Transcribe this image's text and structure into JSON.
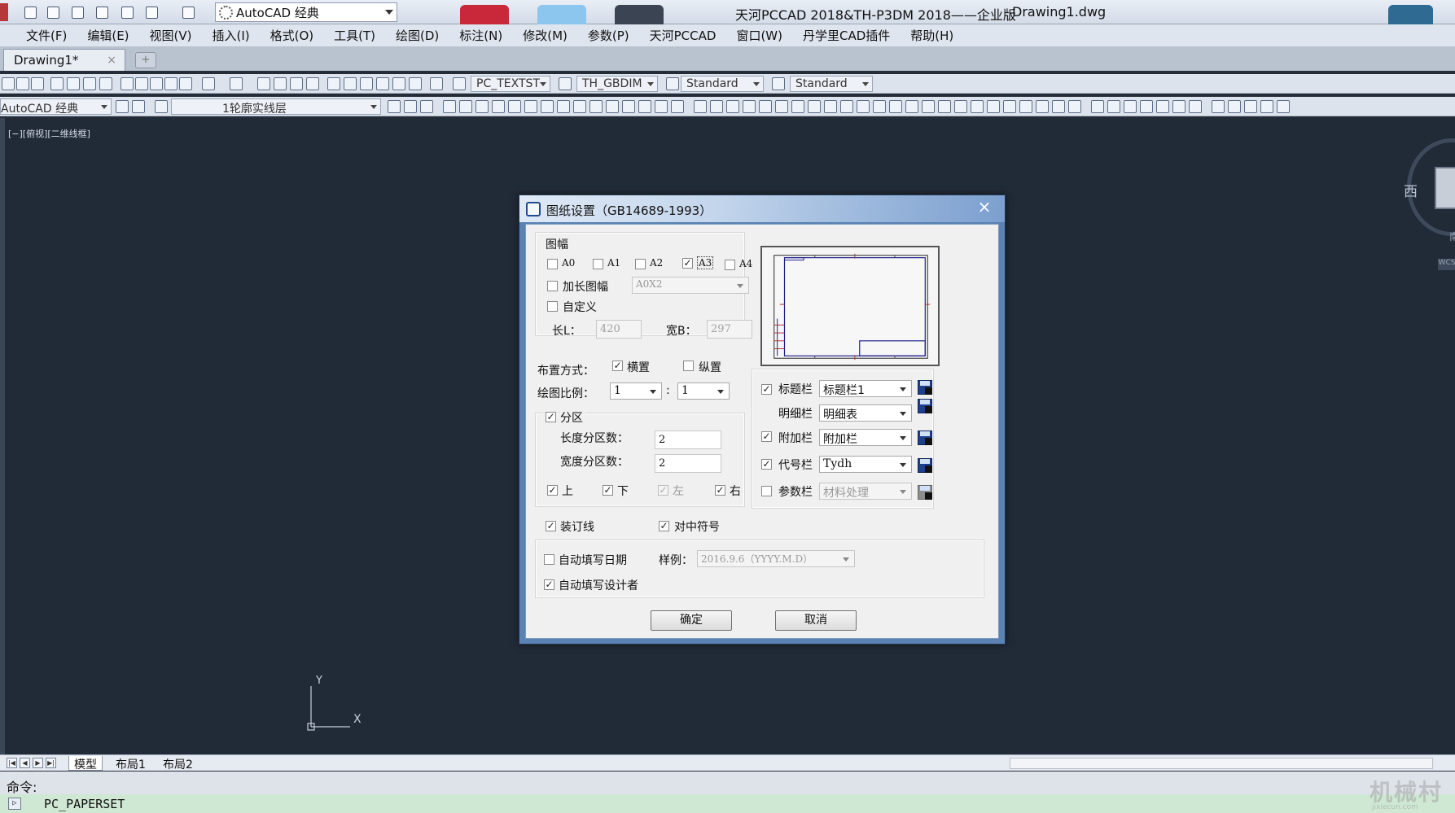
{
  "window": {
    "workspace": "AutoCAD 经典",
    "title": "天河PCCAD 2018&TH-P3DM 2018——企业版",
    "file": "Drawing1.dwg"
  },
  "menu": [
    "文件(F)",
    "编辑(E)",
    "视图(V)",
    "插入(I)",
    "格式(O)",
    "工具(T)",
    "绘图(D)",
    "标注(N)",
    "修改(M)",
    "参数(P)",
    "天河PCCAD",
    "窗口(W)",
    "丹学里CAD插件",
    "帮助(H)"
  ],
  "doc_tab": {
    "label": "Drawing1*",
    "close": "×",
    "new": "+"
  },
  "toolbar": {
    "text_style": "PC_TEXTST",
    "dim_style": "TH_GBDIM",
    "table_style": "Standard",
    "multileader_style": "Standard",
    "workspace2": "AutoCAD 经典",
    "layer": "1轮廓实线层"
  },
  "viewport": {
    "label": "[−][俯视][二维线框]",
    "ucs_x": "X",
    "ucs_y": "Y"
  },
  "viewcube": {
    "west": "西",
    "south": "南",
    "wcs": "WCS"
  },
  "layout_tabs": {
    "model": "模型",
    "layout1": "布局1",
    "layout2": "布局2"
  },
  "command": {
    "label": "命令:",
    "input": "PC_PAPERSET",
    "prompt_icon": "▷"
  },
  "watermark": {
    "main": "机械村",
    "sub": "jixiecun.com"
  },
  "dialog": {
    "title": "图纸设置（GB14689-1993）",
    "close": "×",
    "sheet_group": "图幅",
    "sizes": [
      {
        "label": "A0",
        "checked": false
      },
      {
        "label": "A1",
        "checked": false
      },
      {
        "label": "A2",
        "checked": false
      },
      {
        "label": "A3",
        "checked": true
      },
      {
        "label": "A4",
        "checked": false
      }
    ],
    "extended": {
      "label": "加长图幅",
      "checked": false,
      "value": "A0X2"
    },
    "custom": {
      "label": "自定义",
      "checked": false
    },
    "length": {
      "label": "长L：",
      "value": "420"
    },
    "width": {
      "label": "宽B：",
      "value": "297"
    },
    "layout_mode": {
      "label": "布置方式：",
      "horizontal": "横置",
      "vertical": "纵置",
      "horizontal_checked": true,
      "vertical_checked": false
    },
    "scale": {
      "label": "绘图比例：",
      "left": "1",
      "sep": ":",
      "right": "1"
    },
    "zones": {
      "label": "分区",
      "checked": true,
      "length_label": "长度分区数：",
      "length_value": "2",
      "width_label": "宽度分区数：",
      "width_value": "2",
      "top": "上",
      "bottom": "下",
      "left": "左",
      "right": "右"
    },
    "binding_line": {
      "label": "装订线",
      "checked": true
    },
    "center_mark": {
      "label": "对中符号",
      "checked": true
    },
    "auto_date": {
      "label": "自动填写日期",
      "checked": false,
      "sample_label": "样例：",
      "sample_value": "2016.9.6（YYYY.M.D）"
    },
    "auto_designer": {
      "label": "自动填写设计者",
      "checked": true
    },
    "blocks": [
      {
        "label": "标题栏",
        "checked": true,
        "has_checkbox": true,
        "value": "标题栏1",
        "enabled": true
      },
      {
        "label": "明细栏",
        "checked": false,
        "has_checkbox": false,
        "value": "明细表",
        "enabled": true
      },
      {
        "label": "附加栏",
        "checked": true,
        "has_checkbox": true,
        "value": "附加栏",
        "enabled": true
      },
      {
        "label": "代号栏",
        "checked": true,
        "has_checkbox": true,
        "value": "Tydh",
        "enabled": true
      },
      {
        "label": "参数栏",
        "checked": false,
        "has_checkbox": true,
        "value": "材料处理",
        "enabled": false
      }
    ],
    "ok": "确定",
    "cancel": "取消"
  },
  "colors": {
    "canvas": "#212a37",
    "dialog_frame": "#5a82b3",
    "command_bg": "#cfe8d4"
  }
}
